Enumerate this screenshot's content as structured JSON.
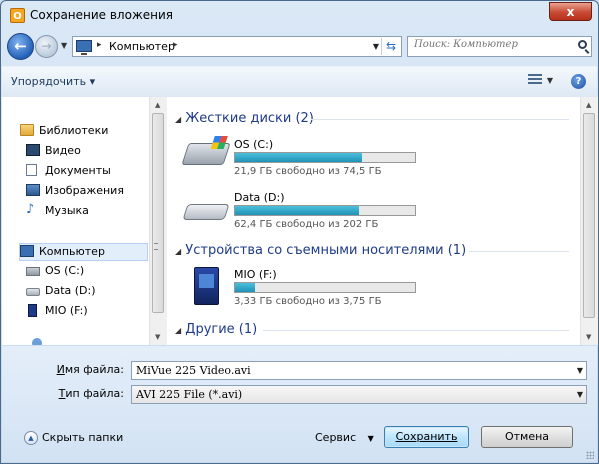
{
  "window": {
    "title": "Сохранение вложения",
    "close_label": "x",
    "app_icon": "outlook-icon"
  },
  "nav": {
    "back_icon": "back-arrow-icon",
    "forward_icon": "forward-arrow-icon",
    "address_separator_left": "▸",
    "address_text": "Компьютер",
    "address_separator_right": "▸",
    "search_placeholder": "Поиск: Компьютер"
  },
  "toolbar": {
    "organize_label": "Упорядочить ▾",
    "help_label": "?"
  },
  "sidebar": {
    "libraries": {
      "label": "Библиотеки",
      "items": [
        {
          "label": "Видео",
          "icon": "video-library-icon"
        },
        {
          "label": "Документы",
          "icon": "documents-library-icon"
        },
        {
          "label": "Изображения",
          "icon": "images-library-icon"
        },
        {
          "label": "Музыка",
          "icon": "music-library-icon"
        }
      ]
    },
    "computer": {
      "label": "Компьютер",
      "items": [
        {
          "label": "OS (C:)",
          "icon": "windows-drive-icon"
        },
        {
          "label": "Data (D:)",
          "icon": "hard-drive-icon"
        },
        {
          "label": "MIO (F:)",
          "icon": "sd-card-icon"
        }
      ]
    }
  },
  "main": {
    "groups": [
      {
        "label": "Жесткие диски (2)"
      },
      {
        "label": "Устройства со съемными носителями (1)"
      },
      {
        "label": "Другие (1)"
      }
    ],
    "drives": [
      {
        "name": "OS (C:)",
        "free_text": "21,9 ГБ свободно из 74,5 ГБ",
        "used_fraction": 0.706
      },
      {
        "name": "Data (D:)",
        "free_text": "62,4 ГБ свободно из 202 ГБ",
        "used_fraction": 0.691
      },
      {
        "name": "MIO (F:)",
        "free_text": "3,33 ГБ свободно из 3,75 ГБ",
        "used_fraction": 0.112
      }
    ]
  },
  "form": {
    "filename_label_u": "И",
    "filename_label_rest": "мя файла:",
    "filename_value": "MiVue 225 Video.avi",
    "filetype_label_u": "Т",
    "filetype_label_rest": "ип файла:",
    "filetype_value": "AVI 225 File (*.avi)"
  },
  "footer": {
    "hide_folders_label": "Скрыть папки",
    "service_label": "Сервис",
    "save_label": "Сохранить",
    "cancel_label": "Отмена"
  },
  "colors": {
    "group_header": "#1e3b8a",
    "progress_fill": "#1f93b7",
    "close_button": "#c74a34"
  }
}
